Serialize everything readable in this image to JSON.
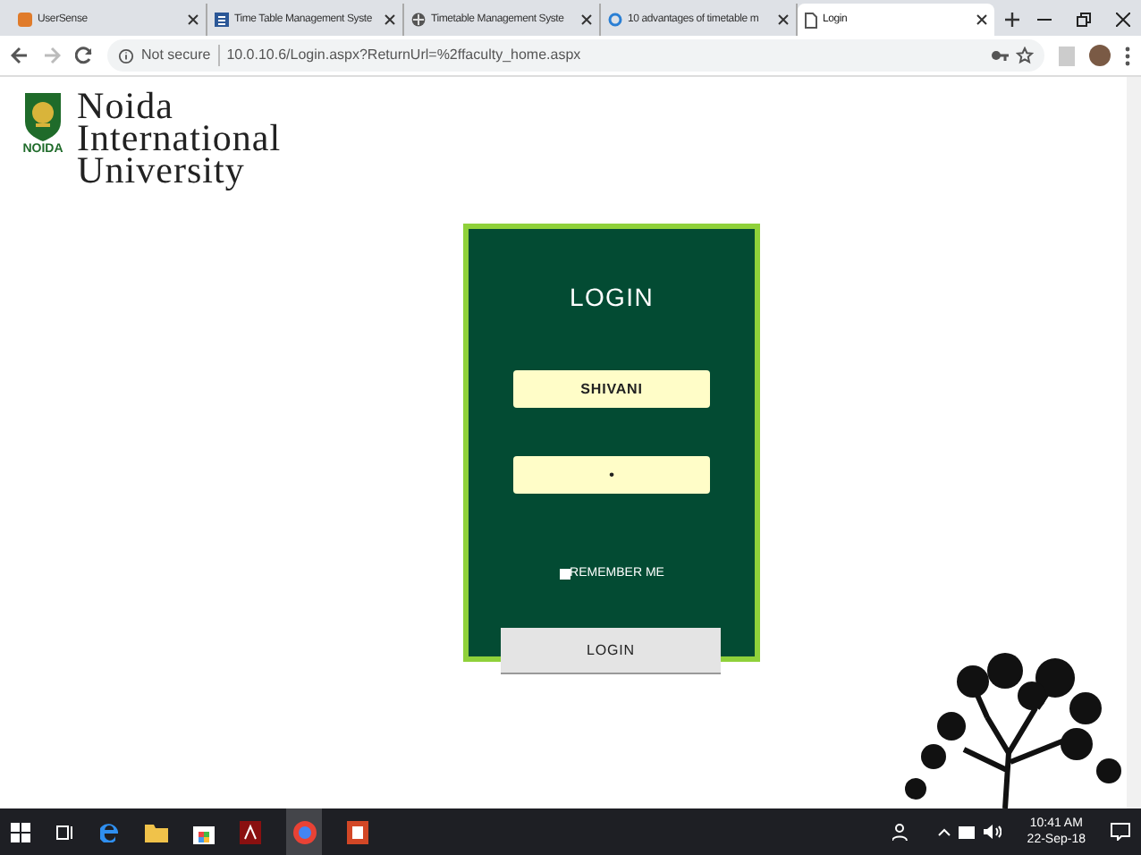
{
  "tabs": [
    {
      "title": "UserSense",
      "selected": false
    },
    {
      "title": "Time Table Management Syste",
      "selected": false
    },
    {
      "title": "Timetable Management Syste",
      "selected": false
    },
    {
      "title": "10 advantages of timetable m",
      "selected": false
    },
    {
      "title": "Login",
      "selected": true
    }
  ],
  "address_bar": {
    "security": "Not secure",
    "url": "10.0.10.6/Login.aspx?ReturnUrl=%2ffaculty_home.aspx"
  },
  "logo": {
    "emblem_text": "NOIDA",
    "lines": [
      "Noida",
      "International",
      "University"
    ]
  },
  "login_form": {
    "title": "LOGIN",
    "username": "SHIVANI",
    "password": "•",
    "remember_me": {
      "label": "REMEMBER ME",
      "checked": false
    },
    "submit": "LOGIN"
  },
  "taskbar": {
    "time": "10:41 AM",
    "date": "22-Sep-18"
  }
}
